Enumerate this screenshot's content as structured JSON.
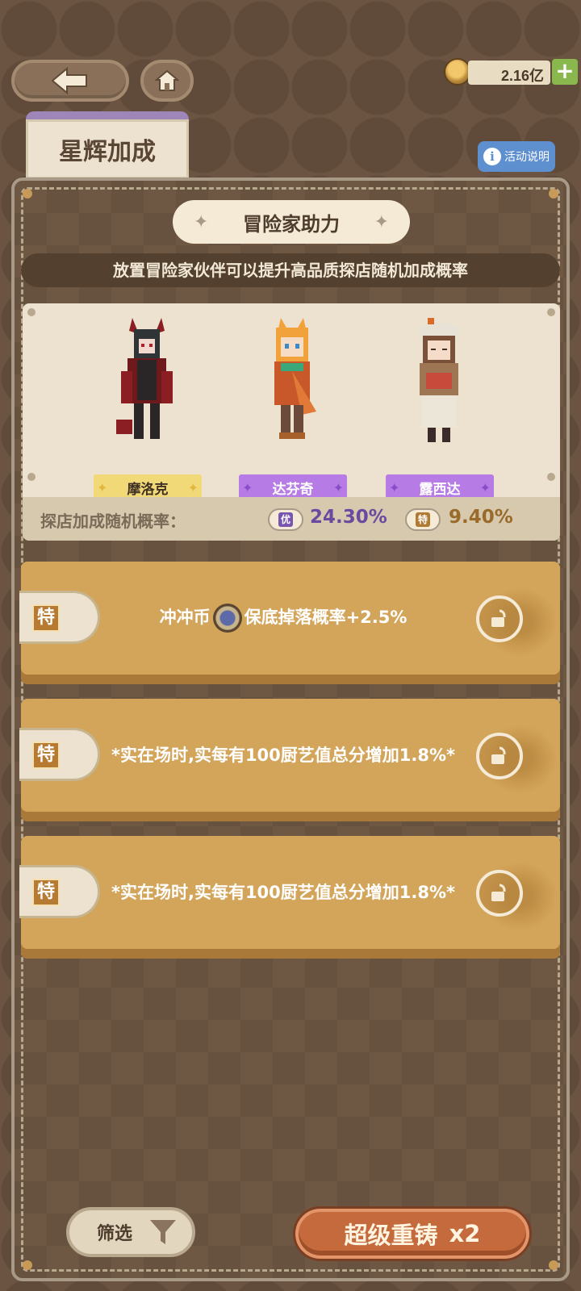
{
  "header": {
    "currency": {
      "icon": "gold-coin-icon",
      "amount": "2.16亿",
      "add_icon": "plus-icon"
    },
    "back_icon": "arrow-left-icon",
    "home_icon": "house-icon"
  },
  "tab": {
    "label": "星辉加成"
  },
  "info_button": {
    "label": "活动说明",
    "icon": "info-icon"
  },
  "section": {
    "title": "冒险家助力",
    "subtitle": "放置冒险家伙伴可以提升高品质探店随机加成概率"
  },
  "characters": [
    {
      "name": "摩洛克",
      "tier_color": "#f2d977"
    },
    {
      "name": "达芬奇",
      "tier_color": "#b77be6"
    },
    {
      "name": "露西达",
      "tier_color": "#b77be6"
    }
  ],
  "rates": {
    "label": "探店加成随机概率：",
    "items": [
      {
        "badge": "优",
        "value": "24.30%",
        "color": "#7a55b0"
      },
      {
        "badge": "特",
        "value": "9.40%",
        "color": "#b07a32"
      }
    ]
  },
  "bonuses": [
    {
      "badge": "特",
      "text_before": "冲冲币",
      "text_after": "保底掉落概率+2.5%",
      "has_coin": true,
      "locked": false
    },
    {
      "badge": "特",
      "text_before": "*实在场时,实每有100厨艺值总分增加1.8%*",
      "text_after": "",
      "has_coin": false,
      "locked": false
    },
    {
      "badge": "特",
      "text_before": "*实在场时,实每有100厨艺值总分增加1.8%*",
      "text_after": "",
      "has_coin": false,
      "locked": false
    }
  ],
  "footer": {
    "filter_label": "筛选",
    "filter_icon": "funnel-icon",
    "reforge_label": "超级重铸",
    "reforge_count": "x2"
  }
}
